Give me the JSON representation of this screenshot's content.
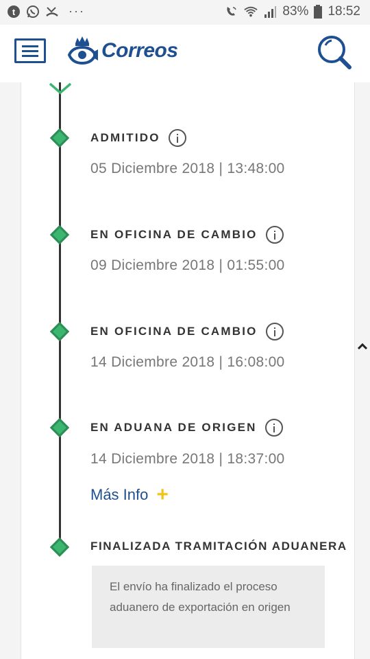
{
  "status_bar": {
    "battery": "83%",
    "time": "18:52",
    "dots": "···",
    "icons": [
      "tumblr-icon",
      "whatsapp-icon",
      "missed-call-icon",
      "wifi-call-icon",
      "wifi-icon",
      "signal-icon",
      "battery-icon"
    ]
  },
  "header": {
    "logo_text": "Correos",
    "icons": [
      "menu-icon",
      "crown-horn-logo-icon",
      "search-icon"
    ]
  },
  "timeline": {
    "events": [
      {
        "status": "ADMITIDO",
        "date": "05 Diciembre 2018 | 13:48:00"
      },
      {
        "status": "EN OFICINA DE CAMBIO",
        "date": "09 Diciembre 2018 | 01:55:00"
      },
      {
        "status": "EN OFICINA DE CAMBIO",
        "date": "14 Diciembre 2018 | 16:08:00"
      },
      {
        "status": "EN ADUANA DE ORIGEN",
        "date": "14 Diciembre 2018 | 18:37:00"
      },
      {
        "status": "FINALIZADA TRAMITACIÓN ADUANERA",
        "date": ""
      }
    ],
    "more_info": "Más Info",
    "more_info_icon": "+",
    "note": "El envío ha finalizado el proceso aduanero de exportación en origen"
  },
  "colors": {
    "brand_blue": "#1d4f91",
    "timeline_green": "#3bb56f",
    "accent_yellow": "#f0c419"
  }
}
